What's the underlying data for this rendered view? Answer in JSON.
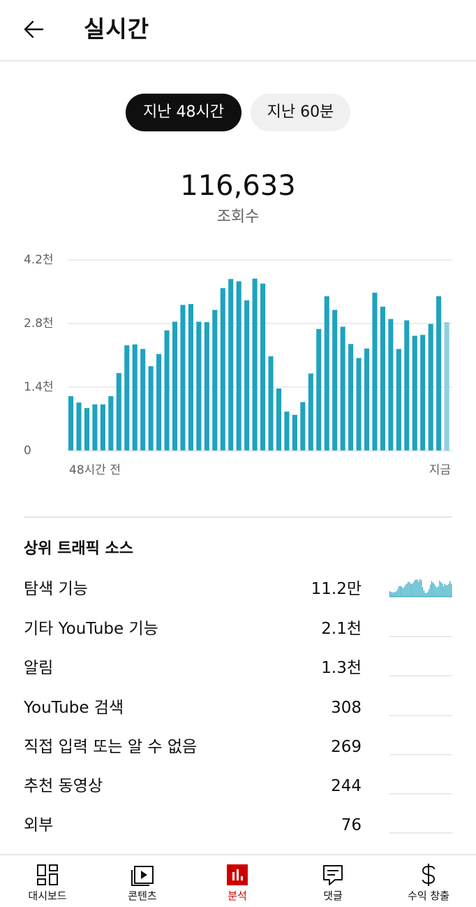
{
  "header": {
    "title": "실시간"
  },
  "range_tabs": [
    {
      "label": "지난 48시간",
      "active": true
    },
    {
      "label": "지난 60분",
      "active": false
    }
  ],
  "summary": {
    "total_views": "116,633",
    "label": "조회수"
  },
  "chart_data": {
    "type": "bar",
    "y_ticks": [
      "4.2천",
      "2.8천",
      "1.4천",
      "0"
    ],
    "x_start_label": "48시간 전",
    "x_end_label": "지금",
    "ylim": [
      0,
      4200
    ],
    "grid": true,
    "bar_color": "#1fa3bd",
    "current_bar_color": "#8fd0de",
    "values": [
      1200,
      1060,
      940,
      1020,
      1020,
      1200,
      1710,
      2320,
      2340,
      2240,
      1860,
      2130,
      2650,
      2840,
      3210,
      3230,
      2840,
      2830,
      3100,
      3580,
      3780,
      3730,
      3310,
      3790,
      3680,
      2080,
      1370,
      860,
      790,
      1070,
      1700,
      2680,
      3400,
      3100,
      2730,
      2350,
      2040,
      2250,
      3480,
      3170,
      2900,
      2240,
      2870,
      2530,
      2550,
      2790,
      3400,
      2830
    ]
  },
  "traffic_sources": {
    "title": "상위 트래픽 소스",
    "rows": [
      {
        "name": "탐색 기능",
        "value": "11.2만",
        "share": 0.96
      },
      {
        "name": "기타 YouTube 기능",
        "value": "2.1천",
        "share": 0.018
      },
      {
        "name": "알림",
        "value": "1.3천",
        "share": 0.011
      },
      {
        "name": "YouTube 검색",
        "value": "308",
        "share": 0.003
      },
      {
        "name": "직접 입력 또는 알 수 없음",
        "value": "269",
        "share": 0.002
      },
      {
        "name": "추천 동영상",
        "value": "244",
        "share": 0.002
      },
      {
        "name": "외부",
        "value": "76",
        "share": 0.001
      }
    ]
  },
  "bottom_nav": [
    {
      "label": "대시보드",
      "icon": "dashboard-icon",
      "active": false
    },
    {
      "label": "콘텐츠",
      "icon": "content-icon",
      "active": false
    },
    {
      "label": "분석",
      "icon": "analytics-icon",
      "active": true
    },
    {
      "label": "댓글",
      "icon": "comments-icon",
      "active": false
    },
    {
      "label": "수익 창출",
      "icon": "monetization-icon",
      "active": false
    }
  ],
  "colors": {
    "accent": "#cc0000",
    "bar": "#1fa3bd",
    "spark": "#1fa3bd",
    "grid": "#e5e5e5"
  }
}
